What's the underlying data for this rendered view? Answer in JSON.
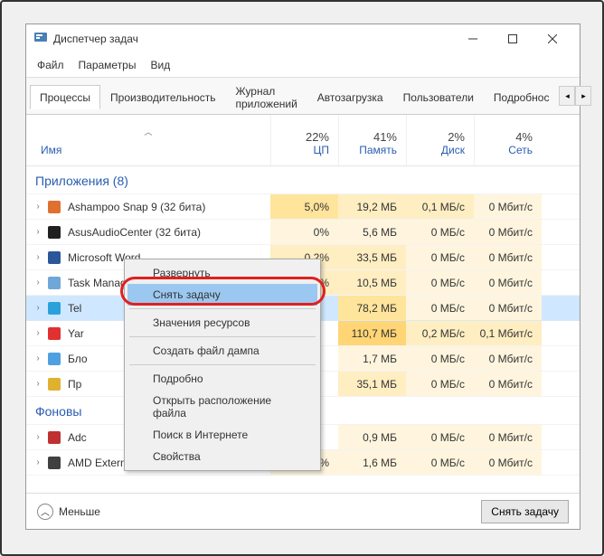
{
  "window": {
    "title": "Диспетчер задач"
  },
  "menubar": [
    "Файл",
    "Параметры",
    "Вид"
  ],
  "tabs": {
    "items": [
      "Процессы",
      "Производительность",
      "Журнал приложений",
      "Автозагрузка",
      "Пользователи",
      "Подробнос"
    ],
    "activeIndex": 0
  },
  "columns": {
    "nameLabel": "Имя",
    "cols": [
      {
        "pct": "22%",
        "label": "ЦП"
      },
      {
        "pct": "41%",
        "label": "Память"
      },
      {
        "pct": "2%",
        "label": "Диск"
      },
      {
        "pct": "4%",
        "label": "Сеть"
      }
    ]
  },
  "groups": [
    {
      "label": "Приложения (8)"
    },
    {
      "label": "Фоновы"
    }
  ],
  "rows_apps": [
    {
      "name": "Ashampoo Snap 9 (32 бита)",
      "vals": [
        "5,0%",
        "19,2 МБ",
        "0,1 МБ/с",
        "0 Мбит/с"
      ],
      "heat": [
        "heat-med",
        "heat-light",
        "heat-light",
        "heat-very-light"
      ]
    },
    {
      "name": "AsusAudioCenter (32 бита)",
      "vals": [
        "0%",
        "5,6 МБ",
        "0 МБ/с",
        "0 Мбит/с"
      ],
      "heat": [
        "heat-very-light",
        "heat-very-light",
        "heat-very-light",
        "heat-very-light"
      ]
    },
    {
      "name": "Microsoft Word",
      "vals": [
        "0,2%",
        "33,5 МБ",
        "0 МБ/с",
        "0 Мбит/с"
      ],
      "heat": [
        "heat-light",
        "heat-light",
        "heat-very-light",
        "heat-very-light"
      ]
    },
    {
      "name": "Task Manager",
      "vals": [
        "1,3%",
        "10,5 МБ",
        "0 МБ/с",
        "0 Мбит/с"
      ],
      "heat": [
        "heat-light",
        "heat-light",
        "heat-very-light",
        "heat-very-light"
      ]
    },
    {
      "name": "Tel",
      "vals": [
        "",
        "78,2 МБ",
        "0 МБ/с",
        "0 Мбит/с"
      ],
      "heat": [
        "",
        "heat-med",
        "heat-very-light",
        "heat-very-light"
      ],
      "selected": true
    },
    {
      "name": "Yar",
      "vals": [
        "",
        "110,7 МБ",
        "0,2 МБ/с",
        "0,1 Мбит/с"
      ],
      "heat": [
        "",
        "heat-strong",
        "heat-light",
        "heat-light"
      ]
    },
    {
      "name": "Бло",
      "vals": [
        "",
        "1,7 МБ",
        "0 МБ/с",
        "0 Мбит/с"
      ],
      "heat": [
        "",
        "heat-very-light",
        "heat-very-light",
        "heat-very-light"
      ]
    },
    {
      "name": "Пр",
      "vals": [
        "",
        "35,1 МБ",
        "0 МБ/с",
        "0 Мбит/с"
      ],
      "heat": [
        "",
        "heat-light",
        "heat-very-light",
        "heat-very-light"
      ]
    }
  ],
  "rows_bg": [
    {
      "name": "Adc",
      "vals": [
        "",
        "0,9 МБ",
        "0 МБ/с",
        "0 Мбит/с"
      ],
      "heat": [
        "",
        "heat-very-light",
        "heat-very-light",
        "heat-very-light"
      ]
    },
    {
      "name": "AMD External Events Client Mo...",
      "vals": [
        "0%",
        "1,6 МБ",
        "0 МБ/с",
        "0 Мбит/с"
      ],
      "heat": [
        "heat-very-light",
        "heat-very-light",
        "heat-very-light",
        "heat-very-light"
      ]
    }
  ],
  "context_menu": {
    "items": [
      "Развернуть",
      "Снять задачу",
      "Значения ресурсов",
      "Создать файл дампа",
      "Подробно",
      "Открыть расположение файла",
      "Поиск в Интернете",
      "Свойства"
    ],
    "highlightedIndex": 1,
    "sepAfter": [
      1,
      2,
      3
    ]
  },
  "footer": {
    "fewer": "Меньше",
    "endTask": "Снять задачу"
  }
}
